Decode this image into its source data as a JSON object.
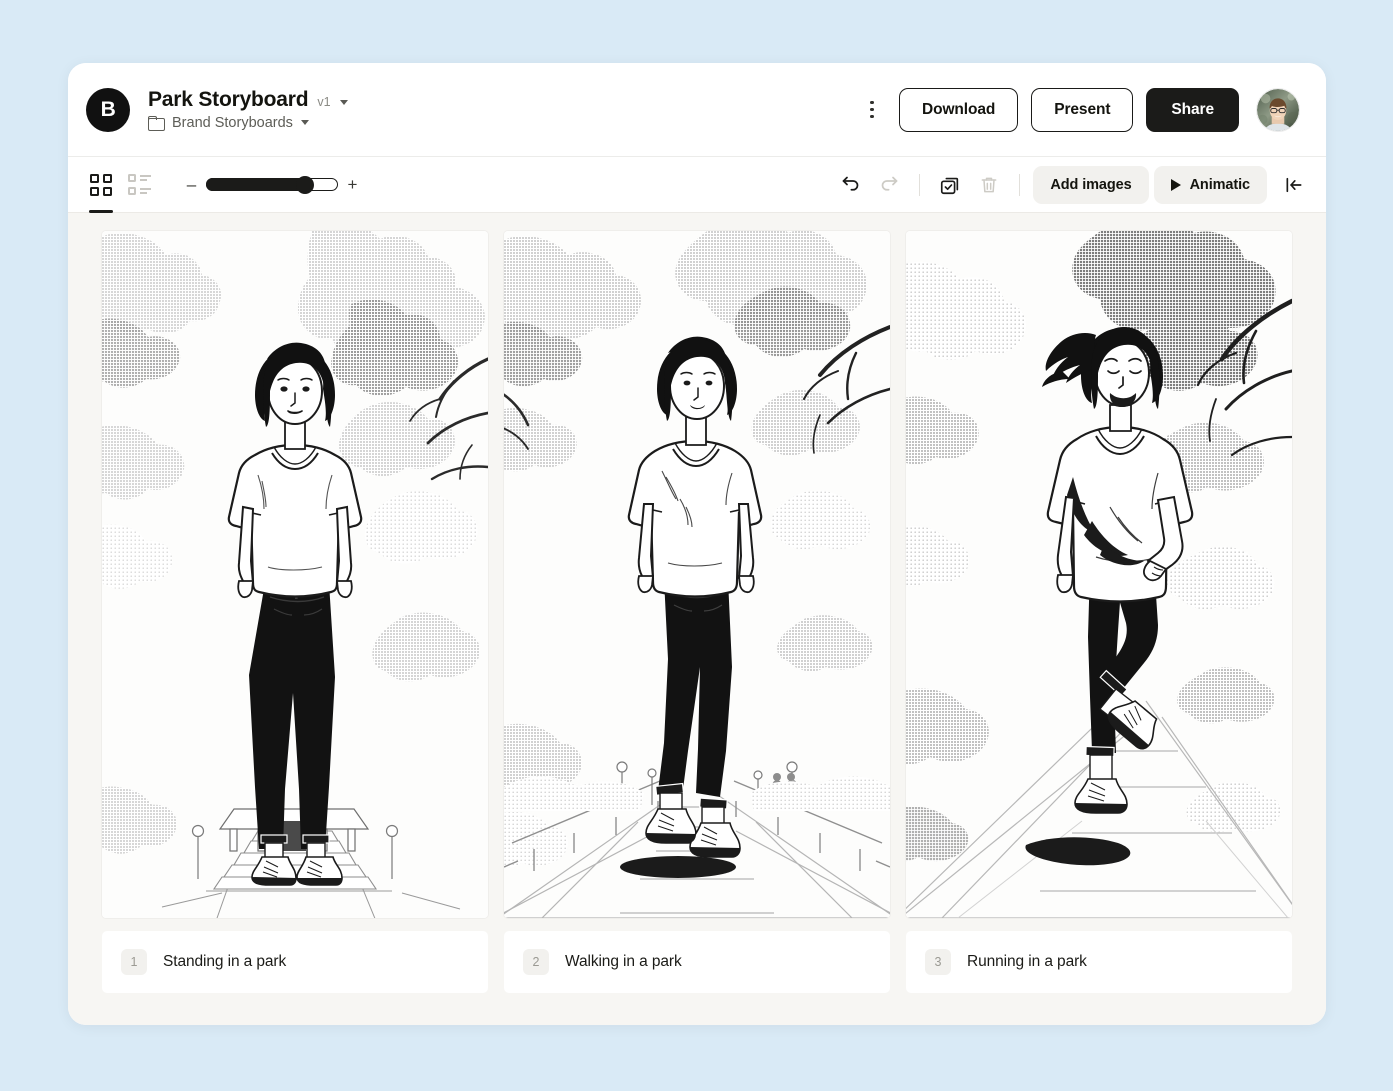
{
  "app": {
    "logo_letter": "B",
    "title": "Park Storyboard",
    "version": "v1",
    "folder": "Brand Storyboards"
  },
  "header": {
    "kebab_icon": "more-vertical-icon",
    "download_label": "Download",
    "present_label": "Present",
    "share_label": "Share",
    "avatar_alt": "User avatar"
  },
  "toolbar": {
    "grid_view_icon": "grid-view-icon",
    "list_view_icon": "list-view-icon",
    "zoom_out_label": "–",
    "zoom_in_label": "+",
    "zoom_percent": 75,
    "undo_icon": "undo-icon",
    "redo_icon": "redo-icon",
    "select_all_icon": "select-all-icon",
    "delete_icon": "trash-icon",
    "add_images_label": "Add images",
    "animatic_label": "Animatic",
    "animatic_play_icon": "play-icon",
    "collapse_icon": "collapse-panel-left-icon"
  },
  "frames": [
    {
      "number": "1",
      "caption": "Standing in a park"
    },
    {
      "number": "2",
      "caption": "Walking in a park"
    },
    {
      "number": "3",
      "caption": "Running in a park"
    }
  ],
  "colors": {
    "page_background": "#d9eaf6",
    "card_background": "#ffffff",
    "canvas_background": "#f7f6f3",
    "accent_dark": "#1b1b19",
    "muted_text": "#8b8b85",
    "pill_background": "#f2f1ee"
  }
}
